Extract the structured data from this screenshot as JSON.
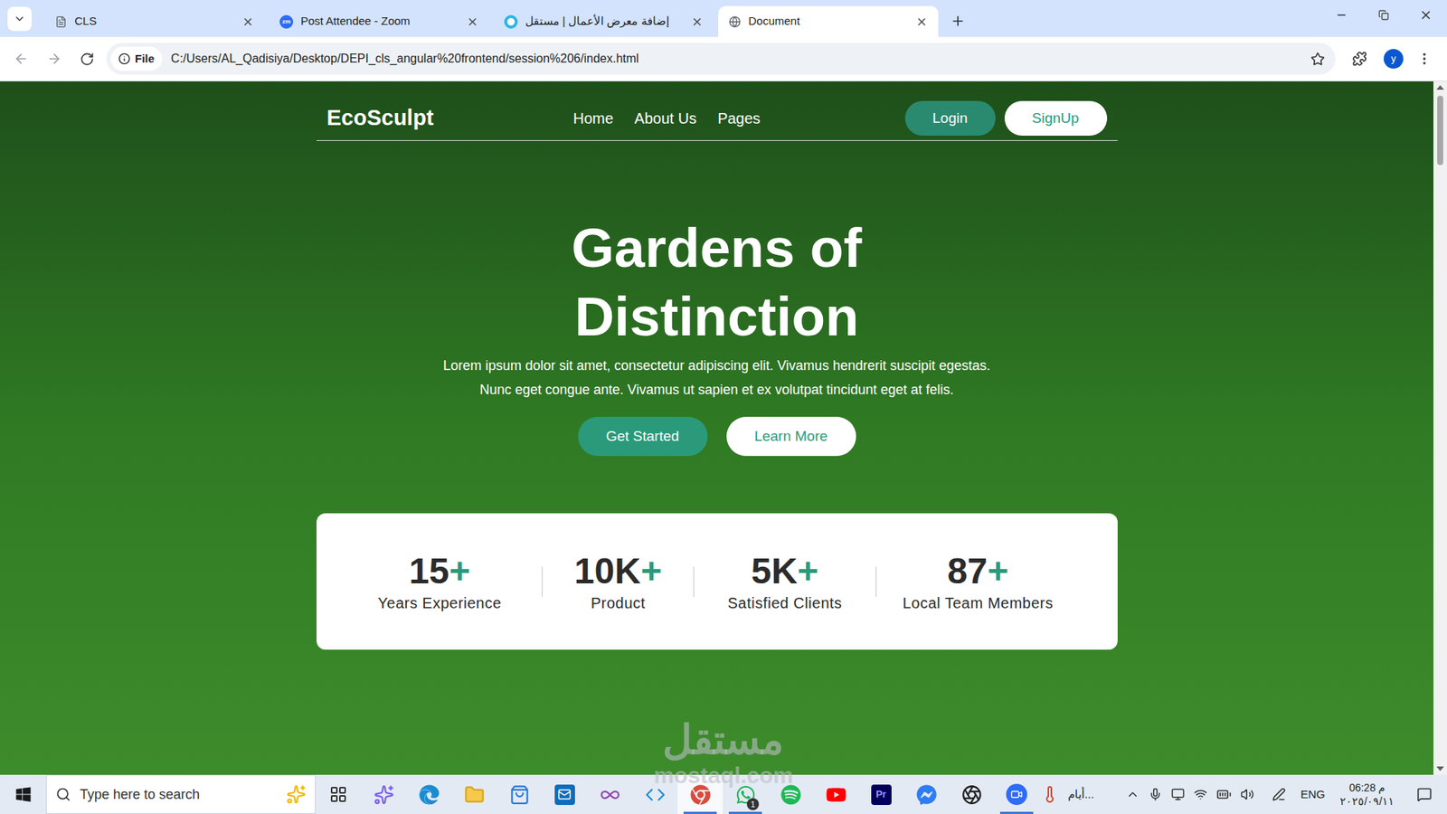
{
  "browser": {
    "tabs": [
      {
        "label": "CLS",
        "selected": false
      },
      {
        "label": "Post Attendee - Zoom",
        "selected": false,
        "icon_text": "zm"
      },
      {
        "label": "إضافة معرض الأعمال | مستقل",
        "selected": false
      },
      {
        "label": "Document",
        "selected": true
      }
    ],
    "address": {
      "chip": "File",
      "url": "C:/Users/AL_Qadisiya/Desktop/DEPI_cls_angular%20frontend/session%206/index.html"
    },
    "profile": "y"
  },
  "page": {
    "nav": {
      "logo": "EcoSculpt",
      "links": [
        "Home",
        "About Us",
        "Pages"
      ],
      "login": "Login",
      "signup": "SignUp"
    },
    "hero": {
      "title": [
        "Gardens of",
        "Distinction"
      ],
      "text": [
        "Lorem ipsum dolor sit amet, consectetur adipiscing elit. Vivamus hendrerit suscipit egestas.",
        "Nunc eget congue ante. Vivamus ut sapien et ex volutpat tincidunt eget at felis."
      ],
      "buttons": [
        {
          "label": "Get Started",
          "kind": "primary"
        },
        {
          "label": "Learn More",
          "kind": "outline"
        }
      ]
    },
    "stats": [
      {
        "value": "15",
        "suffix": "+",
        "label": "Years Experience"
      },
      {
        "value": "10K",
        "suffix": "+",
        "label": "Product"
      },
      {
        "value": "5K",
        "suffix": "+",
        "label": "Satisfied Clients"
      },
      {
        "value": "87",
        "suffix": "+",
        "label": "Local Team Members"
      }
    ]
  },
  "watermark": {
    "arabic": "مستقل",
    "latin": "mostaql.com"
  },
  "taskbar": {
    "search": "Type here to search",
    "apps": [
      {
        "running": false,
        "active": false
      },
      {
        "running": false,
        "active": false
      },
      {
        "running": false,
        "active": false
      },
      {
        "running": false,
        "active": false
      },
      {
        "running": false,
        "active": false
      },
      {
        "running": false,
        "active": false
      },
      {
        "running": false,
        "active": false
      },
      {
        "running": false,
        "active": false
      },
      {
        "running": true,
        "active": true
      },
      {
        "running": true,
        "active": false,
        "badge": "1"
      },
      {
        "running": false,
        "active": false
      },
      {
        "running": false,
        "active": false
      },
      {
        "running": false,
        "active": false,
        "label": "Pr"
      },
      {
        "running": false,
        "active": false
      },
      {
        "running": false,
        "active": false
      },
      {
        "running": true,
        "active": false
      }
    ],
    "tray": {
      "weather": "أيام...",
      "language": "ENG",
      "time": "06:28 م",
      "date": "٢٠٢٥/٠٩/١١"
    }
  }
}
